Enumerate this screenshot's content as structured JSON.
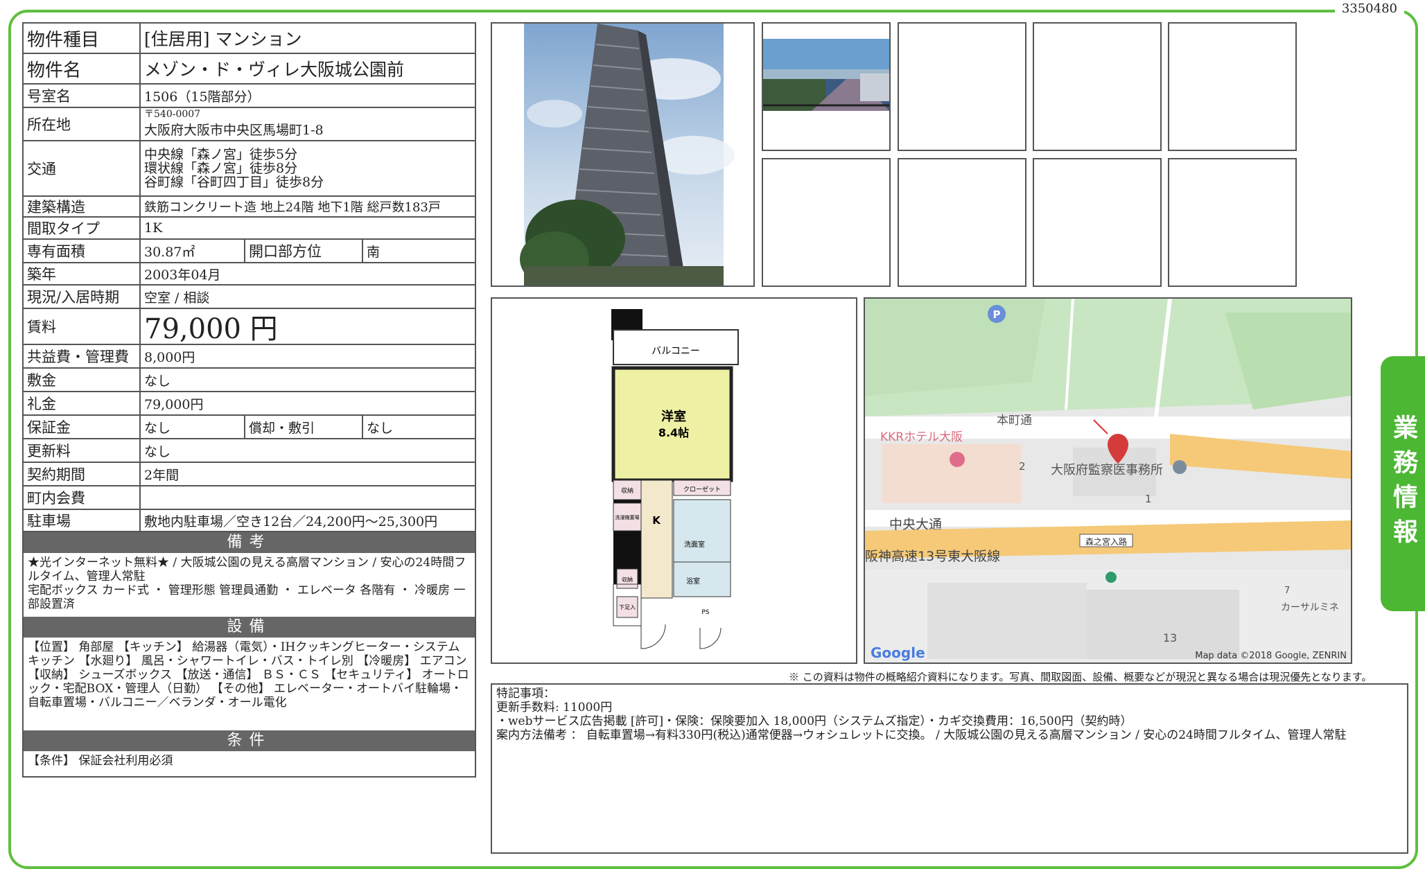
{
  "doc_code": "3350480",
  "side_tab": "業務情報",
  "info": {
    "type_label": "物件種目",
    "type_value": "[住居用] マンション",
    "name_label": "物件名",
    "name_value": "メゾン・ド・ヴィレ大阪城公園前",
    "room_label": "号室名",
    "room_value": "1506（15階部分）",
    "address_label": "所在地",
    "address_zip": "〒540-0007",
    "address_value": "大阪府大阪市中央区馬場町1-8",
    "access_label": "交通",
    "access_lines": [
      "中央線「森ノ宮」徒歩5分",
      "環状線「森ノ宮」徒歩8分",
      "谷町線「谷町四丁目」徒歩8分"
    ],
    "structure_label": "建築構造",
    "structure_value": "鉄筋コンクリート造 地上24階 地下1階 総戸数183戸",
    "layout_label": "間取タイプ",
    "layout_value": "1K",
    "area_label": "専有面積",
    "area_value": "30.87㎡",
    "direction_label": "開口部方位",
    "direction_value": "南",
    "built_label": "築年",
    "built_value": "2003年04月",
    "status_label": "現況/入居時期",
    "status_value": "空室 / 相談",
    "rent_label": "賃料",
    "rent_value": "79,000 円",
    "mgmt_label": "共益費・管理費",
    "mgmt_value": "8,000円",
    "deposit_label": "敷金",
    "deposit_value": "なし",
    "keymoney_label": "礼金",
    "keymoney_value": "79,000円",
    "guarantee_label": "保証金",
    "guarantee_value": "なし",
    "amort_label": "償却・敷引",
    "amort_value": "なし",
    "renewal_label": "更新料",
    "renewal_value": "なし",
    "contract_label": "契約期間",
    "contract_value": "2年間",
    "fee_label": "町内会費",
    "fee_value": "",
    "parking_label": "駐車場",
    "parking_value": "敷地内駐車場／空き12台／24,200円～25,300円"
  },
  "notes": {
    "head": "備考",
    "text": "★光インターネット無料★ / 大阪城公園の見える高層マンション / 安心の24時間フルタイム、管理人常駐\n宅配ボックス カード式 ・ 管理形態 管理員通勤 ・ エレベータ 各階有 ・ 冷暖房 一部設置済"
  },
  "equipment": {
    "head": "設備",
    "text": "【位置】 角部屋 【キッチン】 給湯器（電気）・IHクッキングヒーター・システムキッチン 【水廻り】 風呂・シャワートイレ・バス・トイレ別 【冷暖房】 エアコン 【収納】 シューズボックス 【放送・通信】 ＢＳ・ＣＳ 【セキュリティ】 オートロック・宅配BOX・管理人（日勤） 【その他】 エレベーター・オートバイ駐輪場・自転車置場・バルコニー／ベランダ・オール電化"
  },
  "conditions": {
    "head": "条件",
    "text": "【条件】 保証会社利用必須"
  },
  "floorplan": {
    "balcony": "バルコニー",
    "room": "洋室",
    "room_size": "8.4帖",
    "closet": "クローゼット",
    "kitchen": "K",
    "storage1": "収納",
    "wash_place": "洗濯機置場",
    "washroom": "洗面室",
    "bathroom": "浴室",
    "storage2": "収納",
    "shoes": "下足入",
    "ps": "PS"
  },
  "map": {
    "road1": "本町通",
    "hotel": "KKRホテル大阪",
    "office": "大阪府監察医事務所",
    "road2": "中央大通",
    "highway": "阪神高速13号東大阪線",
    "ramp": "森之宮入路",
    "shop": "カーサルミネ",
    "num2": "2",
    "num1": "1",
    "num7": "7",
    "num13": "13",
    "parking": "P",
    "logo": "Google",
    "attribution": "Map data ©2018 Google, ZENRIN"
  },
  "notice": "※ この資料は物件の概略紹介資料になります。写真、間取図面、設備、概要などが現況と異なる場合は現況優先となります。",
  "remarks": {
    "title": "特記事項：",
    "lines": [
      "更新手数料: 11000円",
      "・webサービス広告掲載 [許可]・保険：保険要加入 18,000円（システムズ指定）・カギ交換費用：16,500円（契約時）",
      "案内方法備考 ： 自転車置場→有料330円(税込)通常便器→ウォシュレットに交換。 / 大阪城公園の見える高層マンション / 安心の24時間フルタイム、管理人常駐"
    ]
  },
  "colors": {
    "frame": "#5fbf3f",
    "tab": "#4cb733",
    "section": "#666666"
  }
}
